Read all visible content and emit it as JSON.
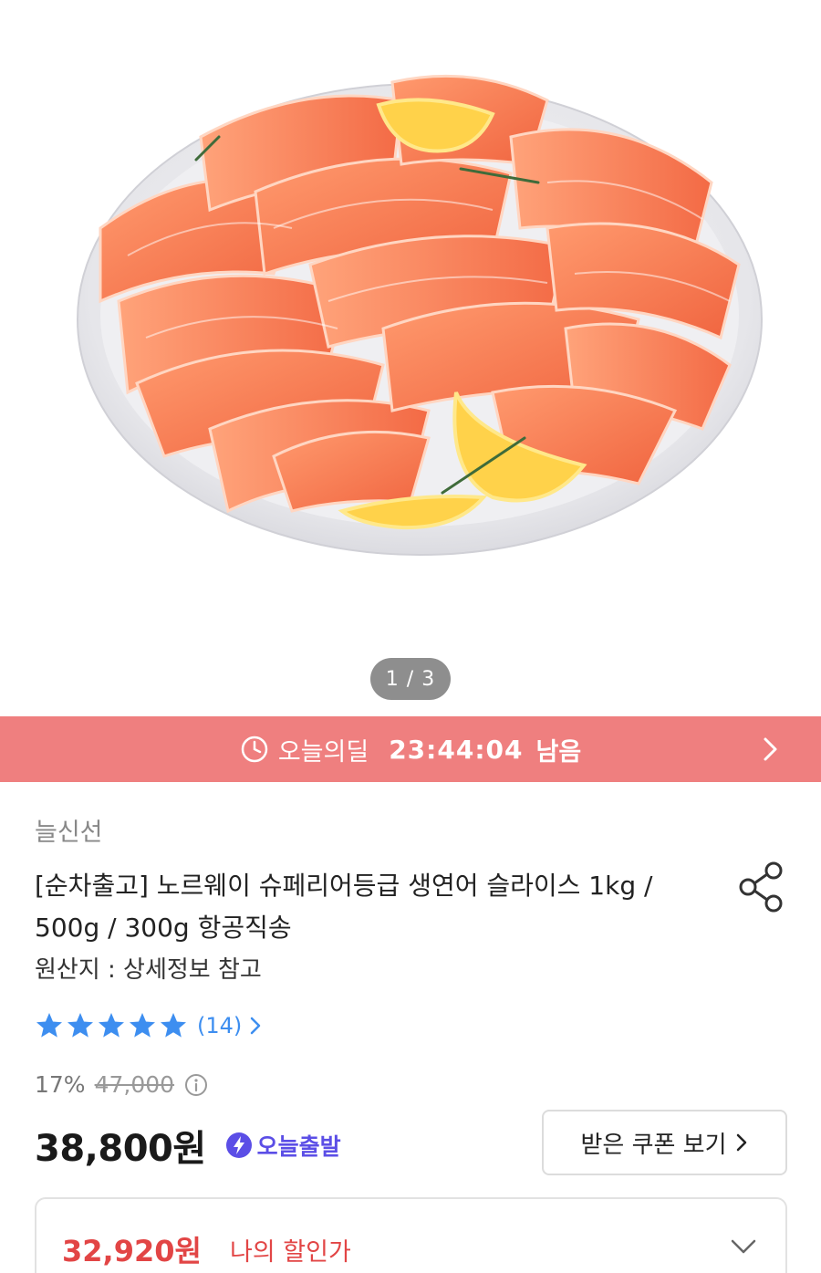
{
  "gallery": {
    "pager": "1 / 3"
  },
  "deal_bar": {
    "label": "오늘의딜",
    "time_left": "23:44:04",
    "remain_label": "남음",
    "color": "#ef7f7f"
  },
  "product": {
    "seller": "늘신선",
    "title": "[순차출고] 노르웨이 슈페리어등급 생연어 슬라이스 1kg / 500g / 300g 항공직송",
    "origin": "원산지 : 상세정보 참고",
    "rating": {
      "stars": 5,
      "count": "(14)"
    },
    "discount_rate": "17%",
    "original_price": "47,000",
    "price": "38,800원",
    "shipping_badge": "오늘출발",
    "coupon_button": "받은 쿠폰 보기",
    "my_price": "32,920원",
    "my_price_label": "나의 할인가"
  },
  "icons": {
    "deal": "clock-icon",
    "deal_arrow": "chevron-right-icon",
    "share": "share-icon",
    "star": "star-icon",
    "info": "info-icon",
    "shipping": "lightning-icon",
    "expand": "chevron-down-icon"
  },
  "colors": {
    "star": "#3d8ef0",
    "shipping": "#5b4ee6",
    "my_price": "#e24545"
  }
}
